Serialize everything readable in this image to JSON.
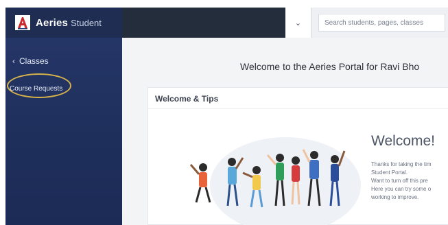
{
  "brand": {
    "name": "Aeries",
    "sub": "Student"
  },
  "sidebar": {
    "back_label": "Classes",
    "items": [
      {
        "label": "Course Requests"
      }
    ]
  },
  "topbar": {
    "search_placeholder": "Search students, pages, classes"
  },
  "main": {
    "welcome_heading": "Welcome to the Aeries Portal for Ravi Bho",
    "card": {
      "title": "Welcome & Tips",
      "welcome_big": "Welcome!",
      "intro_lines": [
        "Thanks for taking the tim",
        "Student Portal.",
        "Want to turn off this pre",
        "Here you can try some o",
        "working to improve."
      ]
    }
  },
  "colors": {
    "sidebar_bg": "#26386a",
    "brand_bg": "#1f2d52",
    "topbar_bg": "#242d3c",
    "highlight": "#d8b34a"
  },
  "icons": [
    "aeries-logo-icon",
    "chevron-left-icon",
    "chevron-down-icon"
  ]
}
